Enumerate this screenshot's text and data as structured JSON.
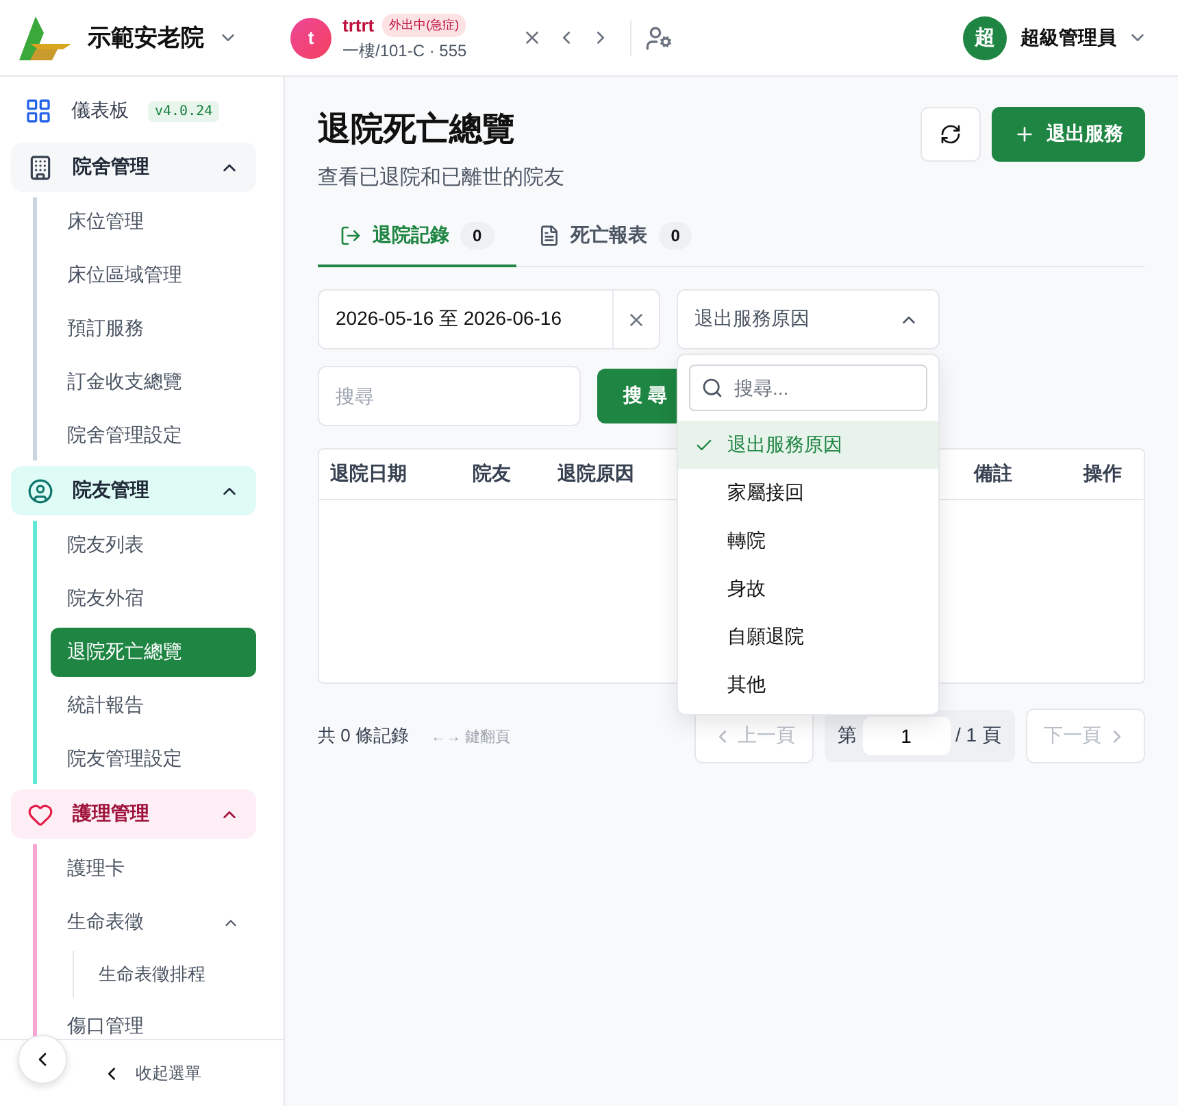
{
  "header": {
    "org_name": "示範安老院",
    "resident": {
      "avatar_letter": "t",
      "name": "trtrt",
      "status_badge": "外出中(急症)",
      "location": "一樓/101-C · 555"
    },
    "user": {
      "avatar_letter": "超",
      "name": "超級管理員"
    }
  },
  "sidebar": {
    "dashboard": {
      "label": "儀表板",
      "version": "v4.0.24"
    },
    "groups": [
      {
        "label": "院舍管理",
        "color": "#cbd5e1",
        "expanded": true,
        "children": [
          {
            "label": "床位管理",
            "selected": false
          },
          {
            "label": "床位區域管理",
            "selected": false
          },
          {
            "label": "預訂服務",
            "selected": false
          },
          {
            "label": "訂金收支總覽",
            "selected": false
          },
          {
            "label": "院舍管理設定",
            "selected": false
          }
        ]
      },
      {
        "label": "院友管理",
        "color": "#5eead4",
        "expanded": true,
        "children": [
          {
            "label": "院友列表",
            "selected": false
          },
          {
            "label": "院友外宿",
            "selected": false
          },
          {
            "label": "退院死亡總覽",
            "selected": true
          },
          {
            "label": "統計報告",
            "selected": false
          },
          {
            "label": "院友管理設定",
            "selected": false
          }
        ]
      },
      {
        "label": "護理管理",
        "color": "#f9a8d4",
        "expanded": true,
        "children": [
          {
            "label": "護理卡",
            "selected": false
          },
          {
            "label": "生命表徵",
            "selected": false,
            "expanded": true,
            "children": [
              {
                "label": "生命表徵排程",
                "selected": false
              }
            ]
          },
          {
            "label": "傷口管理",
            "selected": false
          }
        ]
      }
    ],
    "collapse_label": "收起選單"
  },
  "page": {
    "title": "退院死亡總覽",
    "subtitle": "查看已退院和已離世的院友",
    "primary_button": "退出服務",
    "tabs": [
      {
        "label": "退院記錄",
        "count": "0",
        "selected": true
      },
      {
        "label": "死亡報表",
        "count": "0",
        "selected": false
      }
    ],
    "date_range": "2026-05-16 至 2026-06-16",
    "reason_select": {
      "value": "退出服務原因",
      "expanded": true,
      "search_placeholder": "搜尋...",
      "options": [
        {
          "label": "退出服務原因",
          "selected": true
        },
        {
          "label": "家屬接回",
          "selected": false
        },
        {
          "label": "轉院",
          "selected": false
        },
        {
          "label": "身故",
          "selected": false
        },
        {
          "label": "自願退院",
          "selected": false
        },
        {
          "label": "其他",
          "selected": false
        }
      ]
    },
    "search": {
      "placeholder": "搜尋",
      "button": "搜 尋"
    },
    "table": {
      "columns": [
        "退院日期",
        "院友",
        "退院原因",
        "備註",
        "操作"
      ]
    },
    "footer": {
      "total": "共 0 條記錄",
      "hint": "←→ 鍵翻頁",
      "prev": "上一頁",
      "page_prefix": "第",
      "page": "1",
      "page_suffix": "/ 1 頁",
      "next": "下一頁",
      "prev_disabled": true,
      "next_disabled": true
    }
  }
}
